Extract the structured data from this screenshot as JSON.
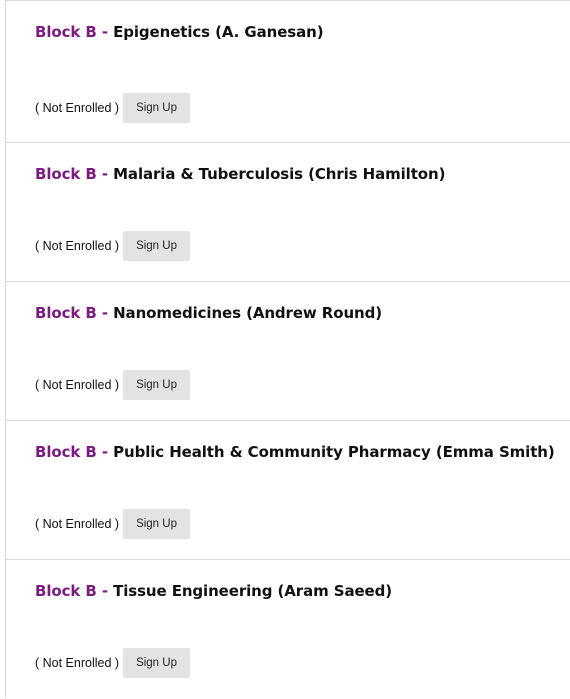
{
  "courses": [
    {
      "block": "Block B",
      "separator": "-",
      "name": "Epigenetics (A. Ganesan)",
      "status": "( Not Enrolled )",
      "action": "Sign Up"
    },
    {
      "block": "Block B",
      "separator": "-",
      "name": "Malaria & Tuberculosis (Chris Hamilton)",
      "status": "( Not Enrolled )",
      "action": "Sign Up"
    },
    {
      "block": "Block B",
      "separator": "-",
      "name": "Nanomedicines (Andrew Round)",
      "status": "( Not Enrolled )",
      "action": "Sign Up"
    },
    {
      "block": "Block B",
      "separator": "-",
      "name": "Public Health & Community Pharmacy (Emma Smith)",
      "status": "( Not Enrolled )",
      "action": "Sign Up"
    },
    {
      "block": "Block B",
      "separator": "-",
      "name": "Tissue Engineering (Aram Saeed)",
      "status": "( Not Enrolled )",
      "action": "Sign Up"
    }
  ],
  "colors": {
    "block_label": "#7b1a80",
    "button_bg": "#e3e3e3",
    "divider": "#d9d9d9"
  }
}
